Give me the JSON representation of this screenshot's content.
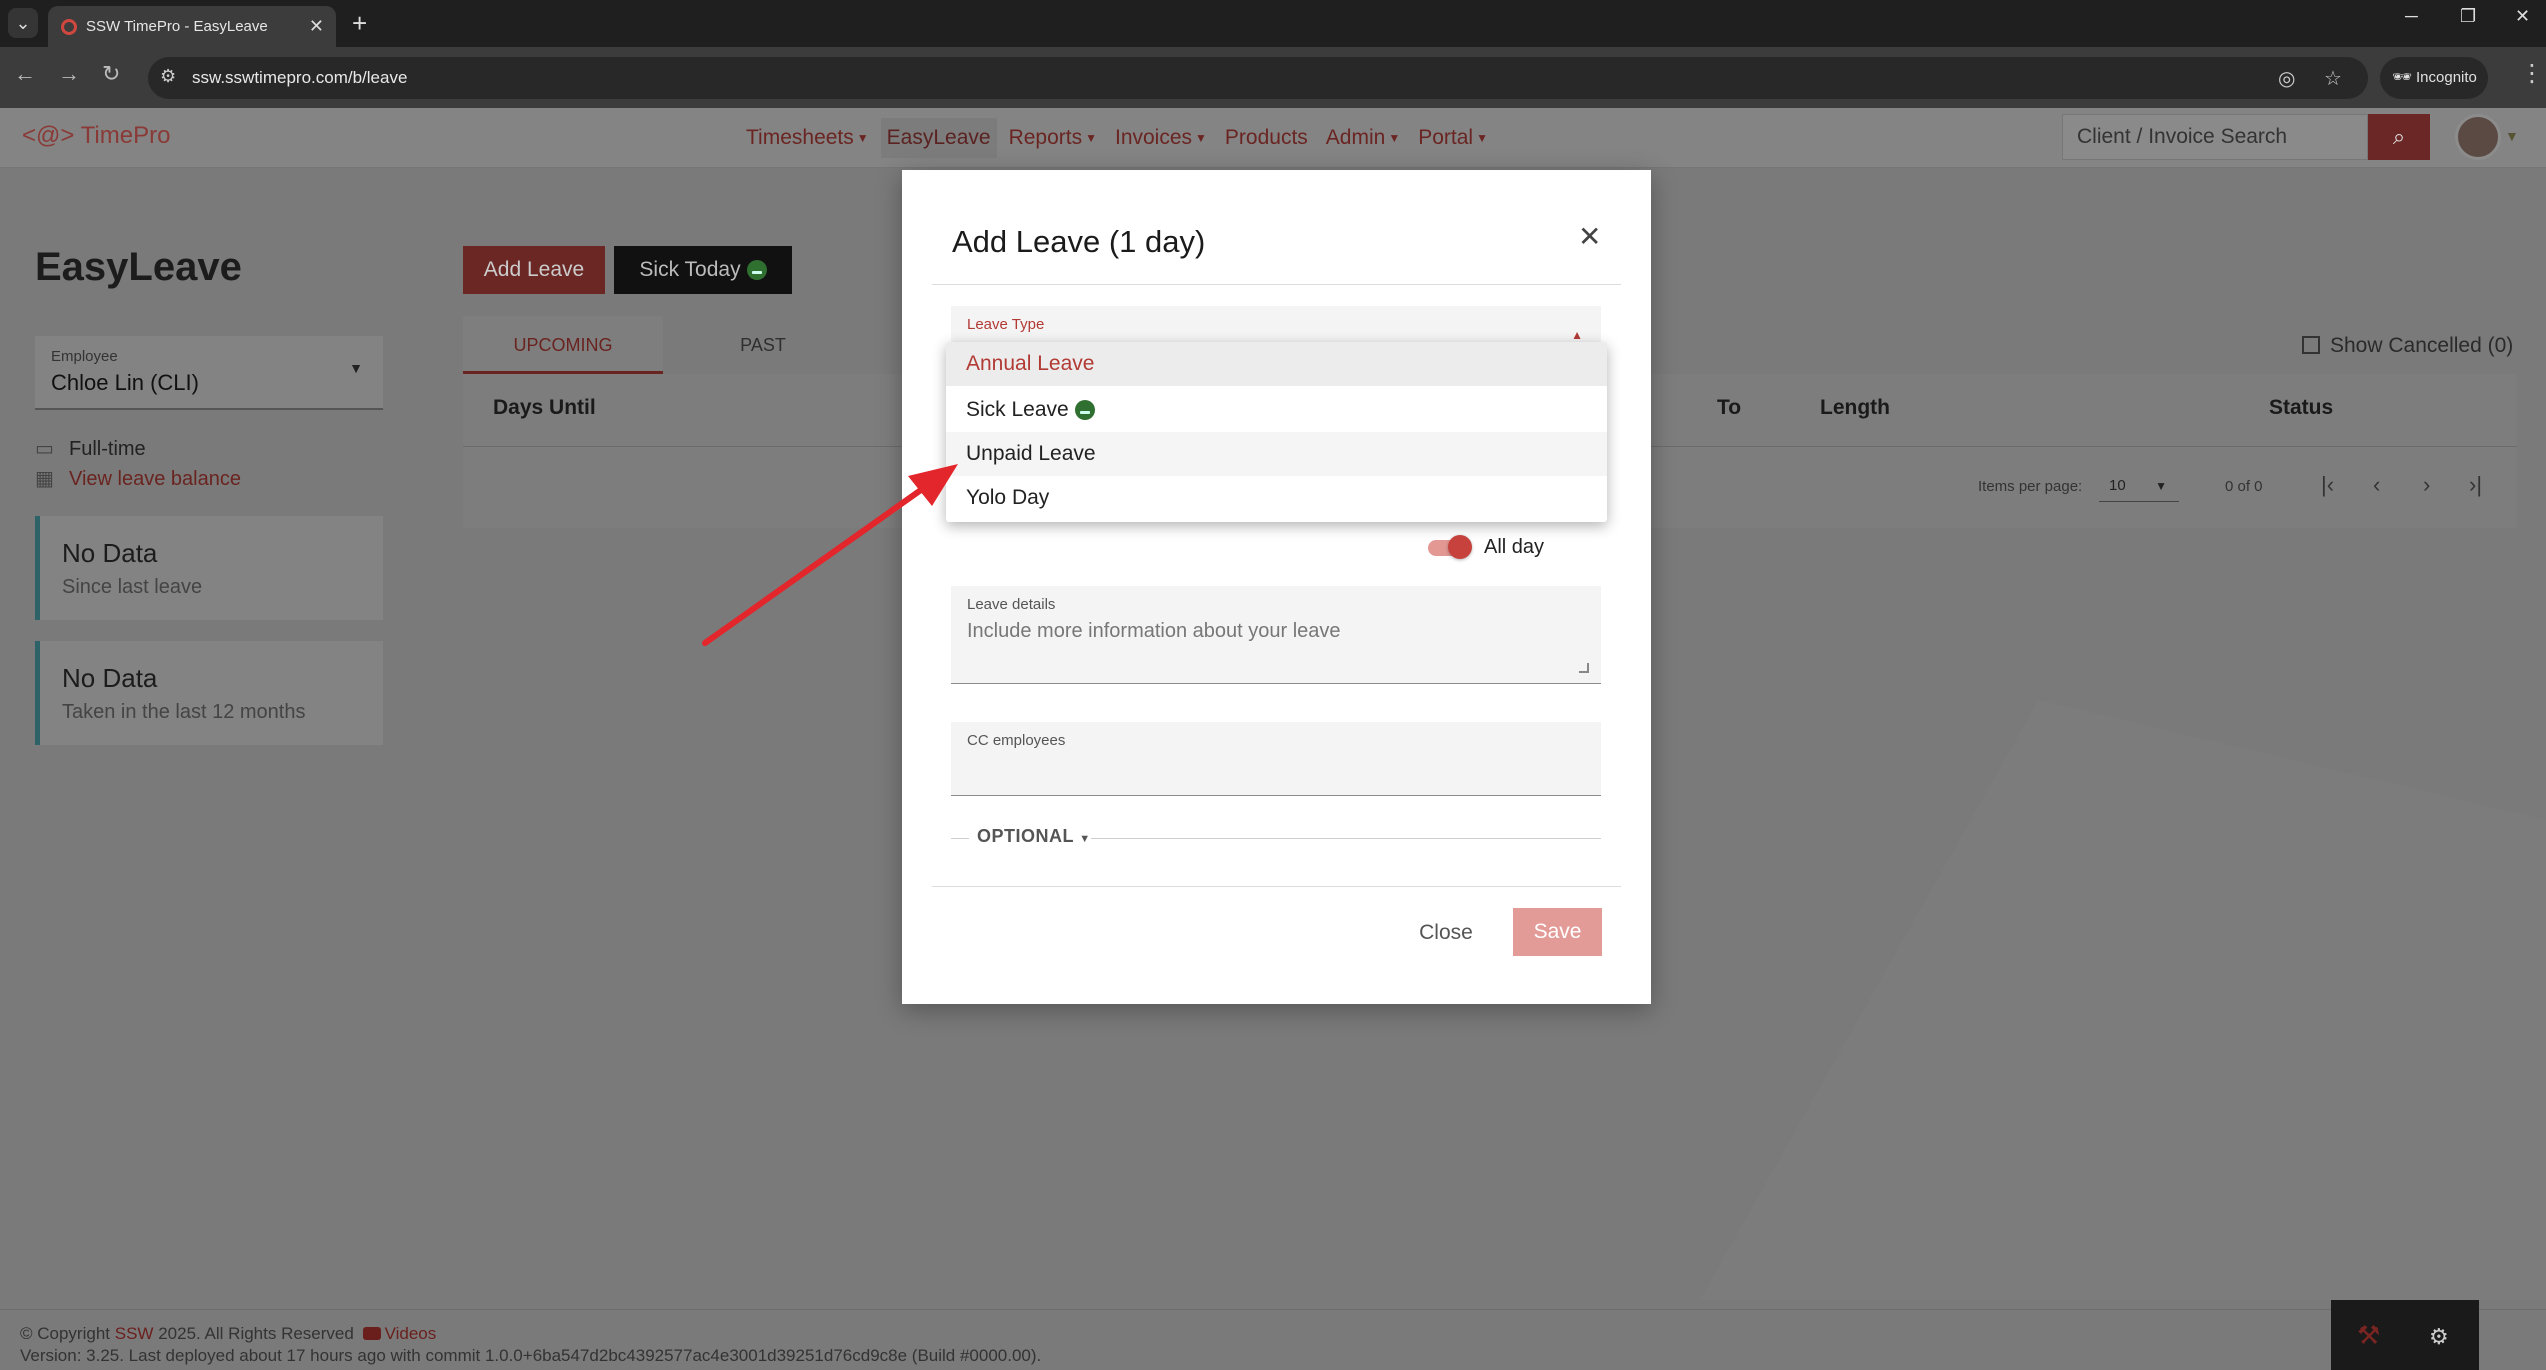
{
  "browser": {
    "tab_title": "SSW TimePro - EasyLeave",
    "url": "ssw.sswtimepro.com/b/leave",
    "incognito_label": "Incognito"
  },
  "header": {
    "logo_text": "TimePro",
    "logo_prefix": "<@>",
    "nav": [
      {
        "label": "Timesheets",
        "dropdown": true
      },
      {
        "label": "EasyLeave",
        "dropdown": false
      },
      {
        "label": "Reports",
        "dropdown": true
      },
      {
        "label": "Invoices",
        "dropdown": true
      },
      {
        "label": "Products",
        "dropdown": false
      },
      {
        "label": "Admin",
        "dropdown": true
      },
      {
        "label": "Portal",
        "dropdown": true
      }
    ],
    "search_placeholder": "Client / Invoice Search"
  },
  "page": {
    "title": "EasyLeave",
    "employee_label": "Employee",
    "employee_value": "Chloe Lin (CLI)",
    "employment_type": "Full-time",
    "view_balance_link": "View leave balance",
    "stat_cards": [
      {
        "big": "No Data",
        "small": "Since last leave"
      },
      {
        "big": "No Data",
        "small": "Taken in the last 12 months"
      }
    ],
    "add_leave_button": "Add Leave",
    "sick_today_button": "Sick Today",
    "tabs": [
      "UPCOMING",
      "PAST"
    ],
    "show_cancelled": "Show Cancelled (0)",
    "table_headers": [
      "Days Until",
      "To",
      "Length",
      "Status"
    ],
    "items_per_page_label": "Items per page:",
    "items_per_page_value": "10",
    "range_label": "0 of 0"
  },
  "modal": {
    "title": "Add Leave (1 day)",
    "leave_type_label": "Leave Type",
    "leave_type_options": [
      "Annual Leave",
      "Sick Leave",
      "Unpaid Leave",
      "Yolo Day"
    ],
    "selected_option": "Annual Leave",
    "all_day_label": "All day",
    "leave_details_label": "Leave details",
    "leave_details_placeholder": "Include more information about your leave",
    "cc_label": "CC employees",
    "optional_label": "OPTIONAL",
    "close_button": "Close",
    "save_button": "Save"
  },
  "footer": {
    "copyright_prefix": "© Copyright",
    "copyright_brand": "SSW",
    "copyright_suffix": "2025. All Rights Reserved",
    "videos_link": "Videos",
    "version_line": "Version: 3.25. Last deployed about 17 hours ago with commit 1.0.0+6ba547d2bc4392577ac4e3001d39251d76cd9c8e (Build #0000.00)."
  },
  "colors": {
    "brand_red": "#b23a35",
    "annotation_arrow": "#e3262b"
  }
}
